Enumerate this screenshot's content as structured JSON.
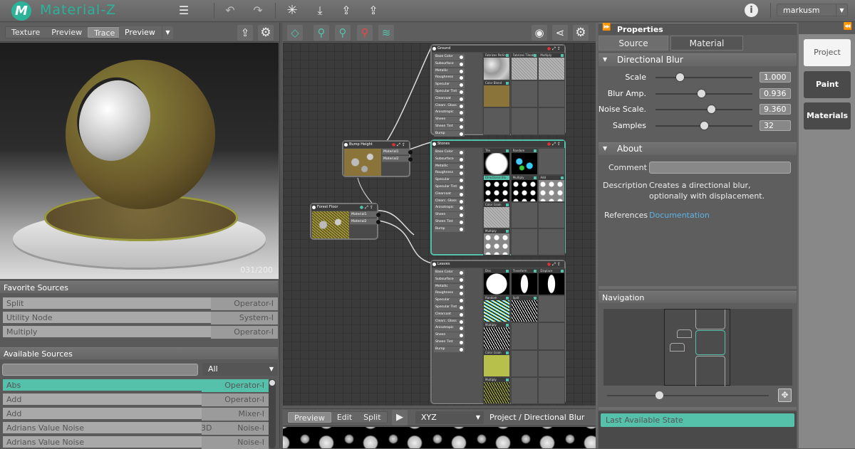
{
  "app": {
    "title": "Material-Z",
    "logo_letter": "M",
    "user": "markusm"
  },
  "colors": {
    "accent": "#55c1ab",
    "link": "#5fb3e6"
  },
  "topbar": {
    "icons": [
      "menu-icon",
      "undo-icon",
      "redo-icon",
      "asterisk-icon",
      "download-icon",
      "upload-icon",
      "upload-plus-icon",
      "info-icon"
    ]
  },
  "left": {
    "view_tabs": [
      "Texture",
      "Preview",
      "Trace"
    ],
    "active_view": "Trace",
    "preview_select": "Preview",
    "frame_counter": "031/200",
    "favorites": {
      "title": "Favorite Sources",
      "items": [
        {
          "name": "Split",
          "type": "Operator-I"
        },
        {
          "name": "Utility Node",
          "type": "System-I"
        },
        {
          "name": "Multiply",
          "type": "Operator-I"
        }
      ]
    },
    "available": {
      "title": "Available Sources",
      "search_value": "",
      "filter": "All",
      "items": [
        {
          "name": "Abs",
          "mid": "",
          "type": "Operator-I",
          "active": true
        },
        {
          "name": "Add",
          "mid": "",
          "type": "Operator-I"
        },
        {
          "name": "Add",
          "mid": "",
          "type": "Mixer-I"
        },
        {
          "name": "Adrians Value Noise",
          "mid": "3D",
          "type": "Noise-I"
        },
        {
          "name": "Adrians Value Noise",
          "mid": "",
          "type": "Noise-I"
        }
      ]
    }
  },
  "graph": {
    "ports": [
      "Base Color",
      "Subsurface",
      "Metallic",
      "Roughness",
      "Specular",
      "Specular Tint",
      "Clearcoat",
      "Clearc. Gloss",
      "Anisotropic",
      "Sheen",
      "Sheen Tint",
      "Bump"
    ],
    "materials": [
      {
        "title": "Ground",
        "rows": 3,
        "selected": false,
        "tiles": [
          {
            "label": "Fabrizes Perlin N",
            "thumb": "noise-soft"
          },
          {
            "label": "Fabrizes Tileable",
            "thumb": "noise-fine"
          },
          {
            "label": "Multiply",
            "thumb": "noise-fine"
          },
          {
            "label": "Color Blend",
            "thumb": "brown"
          }
        ]
      },
      {
        "title": "Stones",
        "rows": 4,
        "selected": true,
        "tiles": [
          {
            "label": "Tile",
            "thumb": "disc-square"
          },
          {
            "label": "Random",
            "thumb": "dots-color"
          },
          null,
          {
            "label": "Directional Blur",
            "thumb": "dots",
            "highlight": true
          },
          {
            "label": "Multiply",
            "thumb": "dots"
          },
          {
            "label": "Add",
            "thumb": "dots-grey"
          },
          {
            "label": "Color Grain",
            "thumb": "noise-fine"
          },
          null,
          null,
          {
            "label": "Multiply",
            "thumb": "dots-grey"
          }
        ]
      },
      {
        "title": "Leaves",
        "rows": 5,
        "selected": false,
        "tiles": [
          {
            "label": "Disc",
            "thumb": "disc"
          },
          {
            "label": "Transform",
            "thumb": "ellipse"
          },
          {
            "label": "Displace",
            "thumb": "ellipse"
          },
          {
            "label": "Random",
            "thumb": "scatter-color"
          },
          {
            "label": "Split",
            "thumb": "scatter"
          },
          null,
          {
            "label": "Multiply",
            "thumb": "scatter"
          },
          null,
          null,
          {
            "label": "Color Grain",
            "thumb": "yellow"
          },
          null,
          null,
          {
            "label": "Multiply",
            "thumb": "leaves"
          }
        ]
      }
    ],
    "mixers": [
      {
        "title": "Bump Height",
        "outputs": [
          "Material1",
          "Material2"
        ],
        "thumb": "brown-stones"
      },
      {
        "title": "Forest Floor",
        "outputs": [
          "Material1",
          "Material2"
        ],
        "thumb": "forest"
      }
    ]
  },
  "bottom": {
    "tabs": [
      "Preview",
      "Edit",
      "Split"
    ],
    "active": "Preview",
    "mode": "XYZ",
    "path": "Project / Directional Blur"
  },
  "properties": {
    "title": "Properties",
    "tabs": [
      "Source",
      "Material"
    ],
    "active_tab": "Source",
    "section": "Directional Blur",
    "params": [
      {
        "label": "Scale",
        "value": "1.000",
        "fraction": 0.25
      },
      {
        "label": "Blur Amp.",
        "value": "0.936",
        "fraction": 0.47
      },
      {
        "label": "Noise Scale.",
        "value": "9.360",
        "fraction": 0.57
      },
      {
        "label": "Samples",
        "value": "32",
        "fraction": 0.5
      }
    ],
    "about": {
      "title": "About",
      "comment_label": "Comment",
      "comment_value": "",
      "description_label": "Description",
      "description_line1": "Creates a directional blur,",
      "description_line2": "optionally with displacement.",
      "references_label": "References",
      "references_link": "Documentation"
    },
    "navigation": {
      "title": "Navigation",
      "zoom_fraction": 0.32
    },
    "history": {
      "items": [
        "Last Available State"
      ]
    }
  },
  "sidebar": {
    "buttons": [
      "Project",
      "Paint",
      "Materials"
    ],
    "active": "Project"
  }
}
